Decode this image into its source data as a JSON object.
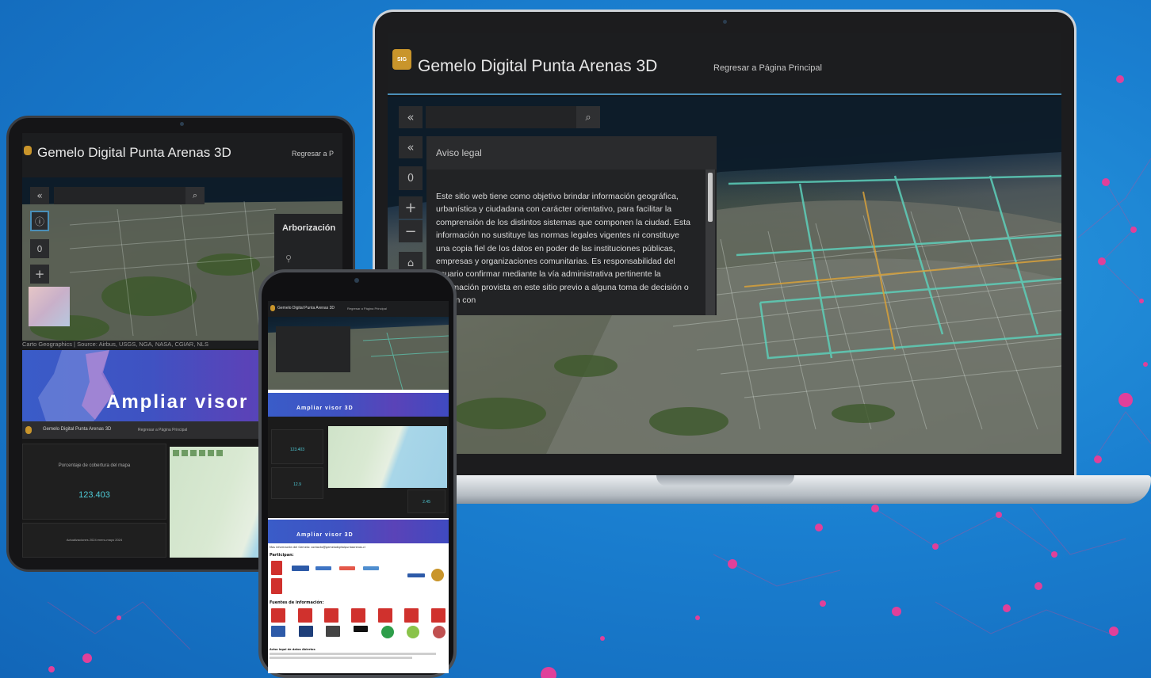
{
  "app": {
    "title": "Gemelo Digital Punta Arenas 3D",
    "link": "Regresar a Página Principal",
    "link_truncated": "Regresar a P",
    "logo_glyph": "SIG"
  },
  "laptop": {
    "panel_title": "Aviso legal",
    "panel_text": "Este sitio web tiene como objetivo brindar información geográfica, urbanística y ciudadana con carácter orientativo, para facilitar la comprensión de los distintos sistemas que componen la ciudad. Esta información no sustituye las normas legales vigentes ni constituye una copia fiel de los datos en poder de las instituciones públicas, empresas y organizaciones comunitarias. Es responsabilidad del usuario confirmar mediante la vía administrativa pertinente la información provista en este sitio previo a alguna toma de decisión o acción con",
    "zoom_value": "0",
    "icons": {
      "collapse": "double-chevron-left-icon",
      "search": "search-icon",
      "zoom_in": "plus-icon",
      "zoom_out": "minus-icon",
      "home": "home-icon"
    }
  },
  "tablet": {
    "panel_title": "Arborización",
    "zoom_value": "0",
    "attribution": "Carto Geographics | Source: Airbus, USGS, NGA, NASA, CGIAR, NLS",
    "banner_text": "Ampliar visor",
    "dash_header_title": "Gemelo Digital Punta Arenas 3D",
    "dash_header_link": "Regresar a Página Principal",
    "dash_metric_label": "Porcentaje de cobertura del mapa",
    "dash_metric_value": "123.403",
    "dash_footer_label": "Actualizaciones 2024 enero-mayo 2024"
  },
  "phone": {
    "header_title": "Gemelo Digital Punta Arenas 3D",
    "header_link": "Regresar a Página Principal",
    "banner_text_1": "Ampliar visor 3D",
    "banner_text_2": "Ampliar visor 3D",
    "metric_1": "123.403",
    "metric_2": "12.9",
    "metric_3": "2.45",
    "section_participan": "Participan:",
    "section_fuentes": "Fuentes de información:",
    "section_contact": "Mas información del Gemelo: contacto@gemelodigitalpuntaarenas.cl",
    "footer_note": "Aviso legal de datos Abiertos"
  },
  "colors": {
    "accent_cyan": "#4ecad6",
    "logo_gold": "#c9952b",
    "banner_blue": "#3f52c2",
    "bg_blue": "#1a7fd0"
  }
}
